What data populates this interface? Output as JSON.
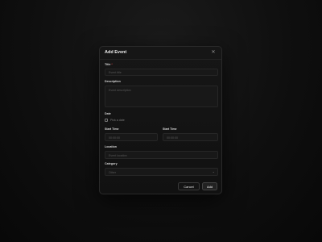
{
  "dialog": {
    "title": "Add Event",
    "close_icon": "close-icon"
  },
  "form": {
    "title": {
      "label": "Title",
      "required_mark": "*",
      "placeholder": "Event title"
    },
    "description": {
      "label": "Description",
      "placeholder": "Event description"
    },
    "date": {
      "label": "Date",
      "picker_text": "Pick a date",
      "icon": "calendar-icon"
    },
    "start_time": {
      "label": "Start Time",
      "placeholder": "00:00:00"
    },
    "end_time": {
      "label": "Start Time",
      "placeholder": "00:00:00"
    },
    "location": {
      "label": "Location",
      "placeholder": "Event location"
    },
    "category": {
      "label": "Category",
      "placeholder": "Other",
      "icon": "chevron-down-icon"
    }
  },
  "actions": {
    "cancel_label": "Cancel",
    "add_label": "Add"
  },
  "colors": {
    "background": "#0b0b0b",
    "dialog": "#141414",
    "border": "#2a2a2a",
    "text": "#e6e6e6",
    "placeholder": "#5a5a5a"
  }
}
